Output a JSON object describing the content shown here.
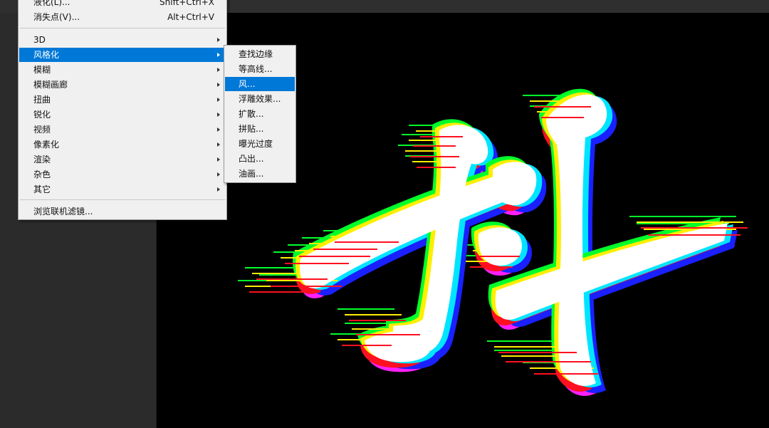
{
  "filter_menu": {
    "items": [
      {
        "label": "液化(L)...",
        "shortcut": "Shift+Ctrl+X"
      },
      {
        "label": "消失点(V)...",
        "shortcut": "Alt+Ctrl+V"
      },
      {
        "label": "3D",
        "has_submenu": true
      },
      {
        "label": "风格化",
        "has_submenu": true,
        "highlighted": true
      },
      {
        "label": "模糊",
        "has_submenu": true
      },
      {
        "label": "模糊画廊",
        "has_submenu": true
      },
      {
        "label": "扭曲",
        "has_submenu": true
      },
      {
        "label": "锐化",
        "has_submenu": true
      },
      {
        "label": "视频",
        "has_submenu": true
      },
      {
        "label": "像素化",
        "has_submenu": true
      },
      {
        "label": "渲染",
        "has_submenu": true
      },
      {
        "label": "杂色",
        "has_submenu": true
      },
      {
        "label": "其它",
        "has_submenu": true
      },
      {
        "label": "浏览联机滤镜..."
      }
    ]
  },
  "stylize_submenu": {
    "items": [
      {
        "label": "查找边缘"
      },
      {
        "label": "等高线..."
      },
      {
        "label": "风...",
        "highlighted": true
      },
      {
        "label": "浮雕效果..."
      },
      {
        "label": "扩散..."
      },
      {
        "label": "拼贴..."
      },
      {
        "label": "曝光过度"
      },
      {
        "label": "凸出..."
      },
      {
        "label": "油画..."
      }
    ]
  },
  "colors": {
    "highlight": "#0078d7",
    "menu_bg": "#f0f0f0",
    "canvas_bg": "#000000",
    "glitch_green": "#00ff2a",
    "glitch_yellow": "#ffee00",
    "glitch_cyan": "#00e5ff",
    "glitch_blue": "#1a20ff",
    "glitch_red": "#ff1020",
    "glitch_magenta": "#ff20ff"
  },
  "icons": {
    "submenu_arrow": "triangle-right"
  }
}
